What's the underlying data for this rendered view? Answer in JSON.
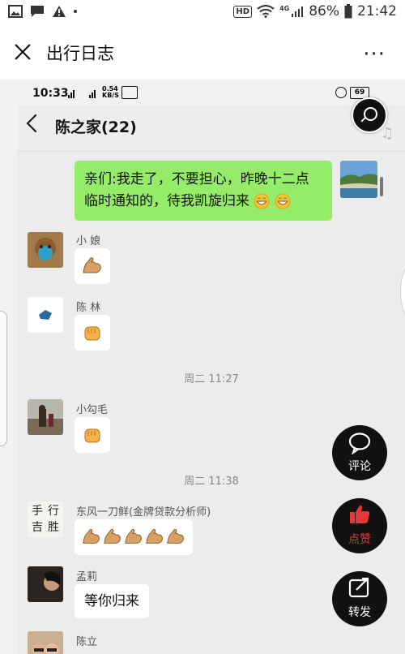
{
  "status_bar": {
    "hd": "HD",
    "network": "4G",
    "battery": "86%",
    "time": "21:42",
    "icons": [
      "image-icon",
      "message-icon",
      "warning-icon",
      "dot-icon",
      "wifi-icon",
      "signal-icon",
      "battery-icon"
    ]
  },
  "top_bar": {
    "title": "出行日志",
    "close_icon": "close-icon",
    "more": "···"
  },
  "inner_status": {
    "time": "10:33",
    "speed": "0.54 KB/S",
    "battery": "69"
  },
  "chat": {
    "title": "陈之家(22)",
    "messages": [
      {
        "sender": "",
        "text": "亲们:我走了，不要担心，昨晚十二点临时通知的，待我凯旋归来",
        "side": "right",
        "emoji": [
          "grin",
          "grin"
        ]
      },
      {
        "sender": "小 娘",
        "text": "",
        "emoji": [
          "muscle"
        ]
      },
      {
        "sender": "陈 林",
        "text": "",
        "emoji": [
          "fist"
        ]
      },
      {
        "sender": "小勾毛",
        "text": "",
        "emoji": [
          "fist"
        ]
      },
      {
        "sender": "东风一刀鲜(金牌贷款分析师)",
        "text": "",
        "emoji": [
          "muscle",
          "muscle",
          "muscle",
          "muscle",
          "muscle"
        ]
      },
      {
        "sender": "孟莉",
        "text": "等你归来",
        "emoji": []
      },
      {
        "sender": "陈立",
        "text": "",
        "emoji": []
      }
    ],
    "timestamps": [
      "周二 11:27",
      "周二 11:38"
    ],
    "avatar_text": [
      "手",
      "行",
      "吉",
      "胜"
    ]
  },
  "actions": {
    "comment": "评论",
    "like": "点赞",
    "share": "转发"
  },
  "colors": {
    "green_bubble": "#95ec69",
    "like_red": "#e53935",
    "fab_bg": "#111111"
  }
}
